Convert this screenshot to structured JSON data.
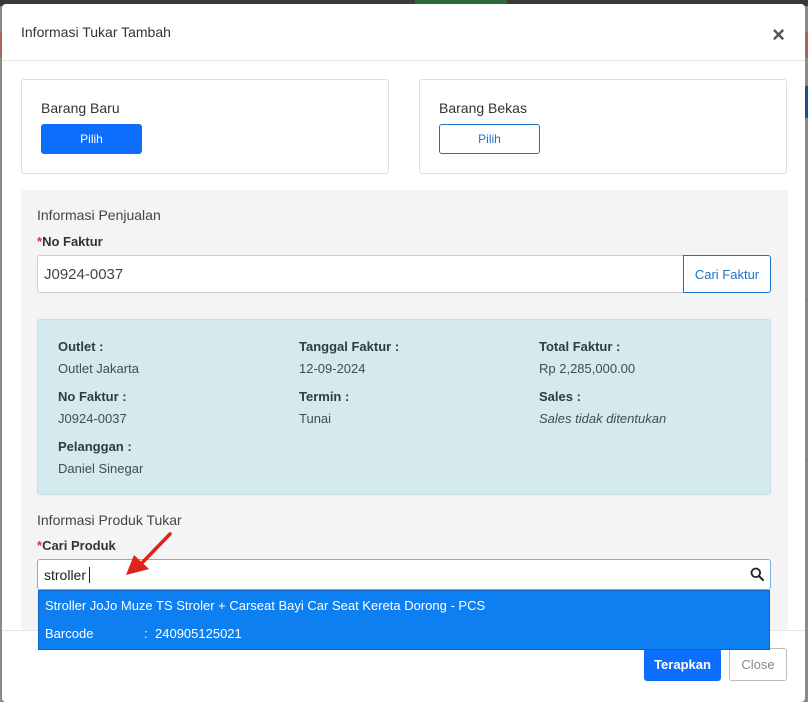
{
  "modal": {
    "title": "Informasi Tukar Tambah",
    "close_symbol": "×"
  },
  "barang_baru": {
    "title": "Barang Baru",
    "button_label": "Pilih"
  },
  "barang_bekas": {
    "title": "Barang Bekas",
    "button_label": "Pilih"
  },
  "penjualan": {
    "section_title": "Informasi Penjualan",
    "no_faktur_label": "No Faktur",
    "required_mark": "*",
    "no_faktur_value": "J0924-0037",
    "cari_faktur_label": "Cari Faktur"
  },
  "invoice_info": {
    "outlet_label": "Outlet :",
    "outlet_value": "Outlet Jakarta",
    "tanggal_label": "Tanggal Faktur :",
    "tanggal_value": "12-09-2024",
    "total_label": "Total Faktur :",
    "total_value": "Rp 2,285,000.00",
    "no_faktur_label": "No Faktur :",
    "no_faktur_value": "J0924-0037",
    "termin_label": "Termin :",
    "termin_value": "Tunai",
    "sales_label": "Sales :",
    "sales_value": "Sales tidak ditentukan",
    "pelanggan_label": "Pelanggan :",
    "pelanggan_value": "Daniel Sinegar"
  },
  "produk_tukar": {
    "section_title": "Informasi Produk Tukar",
    "cari_produk_label": "Cari Produk",
    "required_mark": "*",
    "search_value": "stroller",
    "search_icon": "search-icon"
  },
  "dropdown": {
    "product_name": "Stroller JoJo Muze TS Stroler + Carseat Bayi Car Seat Kereta Dorong - PCS",
    "barcode_label": "Barcode",
    "barcode_sep": ":",
    "barcode_value": "240905125021"
  },
  "footer": {
    "apply_label": "Terapkan",
    "close_label": "Close"
  },
  "colors": {
    "primary": "#0d6efd",
    "dropdown_bg": "#0d7ff0",
    "info_bg": "#d4eaee",
    "required": "#d9302c",
    "arrow": "#e0231a"
  }
}
